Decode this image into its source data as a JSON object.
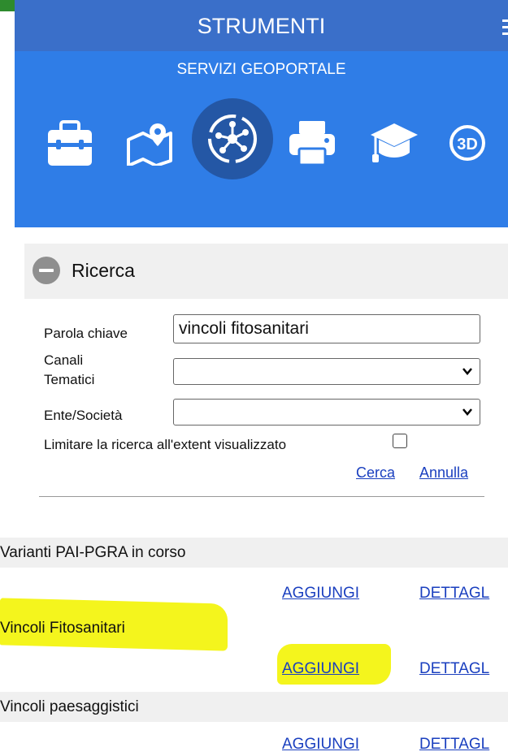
{
  "header": {
    "title": "STRUMENTI",
    "subtitle": "SERVIZI GEOPORTALE"
  },
  "tools": [
    {
      "icon": "toolbox-icon",
      "active": false
    },
    {
      "icon": "map-pin-icon",
      "active": false
    },
    {
      "icon": "network-icon",
      "active": true
    },
    {
      "icon": "printer-icon",
      "active": false
    },
    {
      "icon": "graduation-cap-icon",
      "active": false
    },
    {
      "icon": "3d-icon",
      "label": "3D",
      "active": false
    }
  ],
  "search": {
    "title": "Ricerca",
    "keyword_label": "Parola chiave",
    "keyword_value": "vincoli fitosanitari",
    "channels_label_1": "Canali",
    "channels_label_2": "Tematici",
    "channels_value": "",
    "entity_label": "Ente/Società",
    "entity_value": "",
    "limit_label": "Limitare la ricerca all'extent visualizzato",
    "limit_checked": false,
    "search_link": "Cerca",
    "cancel_link": "Annulla"
  },
  "results": [
    {
      "title": "Varianti PAI-PGRA in corso",
      "add": "AGGIUNGI",
      "details": "DETTAGL"
    },
    {
      "title": "Vincoli Fitosanitari",
      "add": "AGGIUNGI",
      "details": "DETTAGL"
    },
    {
      "title": "Vincoli paesaggistici",
      "add": "AGGIUNGI",
      "details": "DETTAGL"
    }
  ],
  "colors": {
    "header": "#3a6fc9",
    "panel": "#2f7de7",
    "active_tool": "#2457a5",
    "link": "#1a3fbf",
    "highlight": "#f4f51d"
  }
}
